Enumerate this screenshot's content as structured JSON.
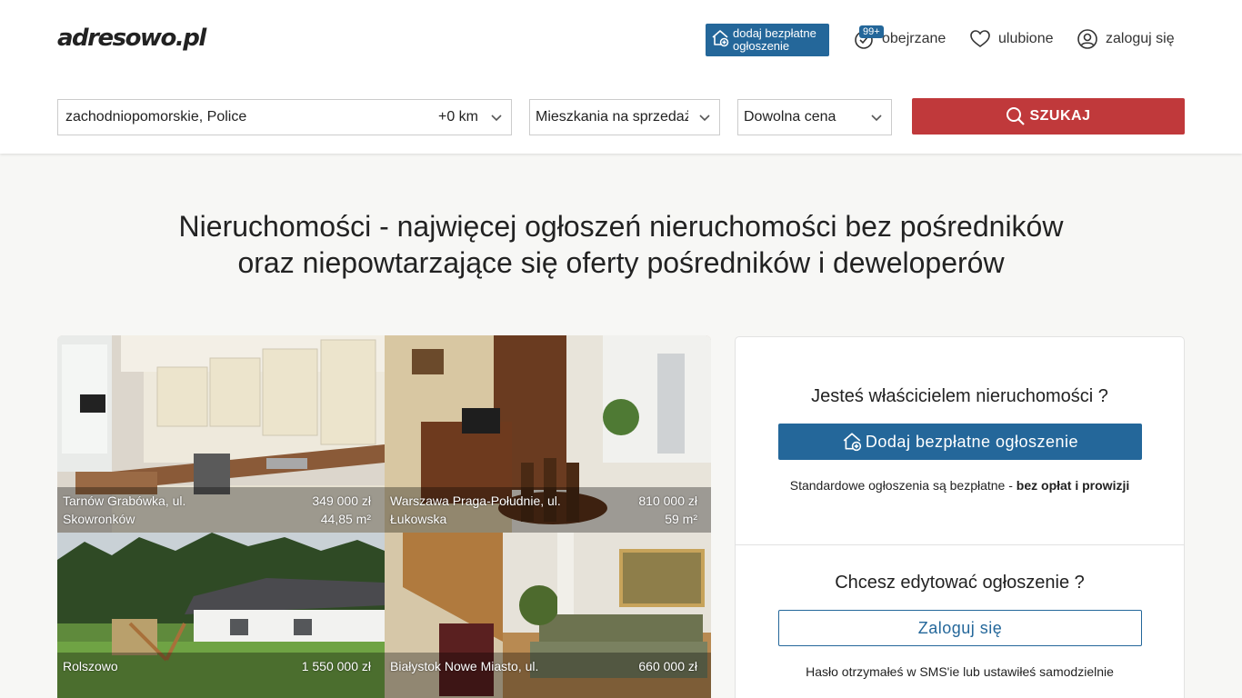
{
  "header": {
    "logo": "adresowo.pl",
    "add_listing_label": "dodaj bezpłatne ogłoszenie",
    "viewed_label": "obejrzane",
    "viewed_badge": "99+",
    "favorites_label": "ulubione",
    "login_label": "zaloguj się"
  },
  "search": {
    "location_value": "zachodniopomorskie,  Police",
    "radius_value": "+0 km",
    "property_type_value": "Mieszkania na sprzedaż",
    "price_value": "Dowolna cena",
    "submit_label": "SZUKAJ"
  },
  "headline": {
    "line1": "Nieruchomości - najwięcej ogłoszeń nieruchomości bez pośredników",
    "line2": "oraz niepowtarzające się oferty pośredników i deweloperów"
  },
  "listings": [
    {
      "address": "Tarnów Grabówka, ul. Skowronków",
      "price": "349 000 zł",
      "area": "44,85 m²"
    },
    {
      "address": "Warszawa Praga-Południe, ul. Łukowska",
      "price": "810 000 zł",
      "area": "59 m²"
    },
    {
      "address": "Rolszowo",
      "price": "1 550 000 zł",
      "area": ""
    },
    {
      "address": "Białystok Nowe Miasto, ul.",
      "price": "660 000 zł",
      "area": ""
    }
  ],
  "owner_panel": {
    "owner_question": "Jesteś właścicielem nieruchomości ?",
    "add_button_label": "Dodaj bezpłatne ogłoszenie",
    "free_note_prefix": "Standardowe ogłoszenia są bezpłatne - ",
    "free_note_bold": "bez opłat i prowizji",
    "edit_question": "Chcesz edytować ogłoszenie ?",
    "login_button_label": "Zaloguj się",
    "password_note": "Hasło otrzymałeś w SMS'ie lub ustawiłeś samodzielnie"
  },
  "colors": {
    "brand_blue": "#24679a",
    "search_red": "#c0393b"
  },
  "icons": [
    "house-plus-icon",
    "check-badge-icon",
    "heart-icon",
    "user-circle-icon",
    "chevron-down-icon",
    "search-icon"
  ]
}
